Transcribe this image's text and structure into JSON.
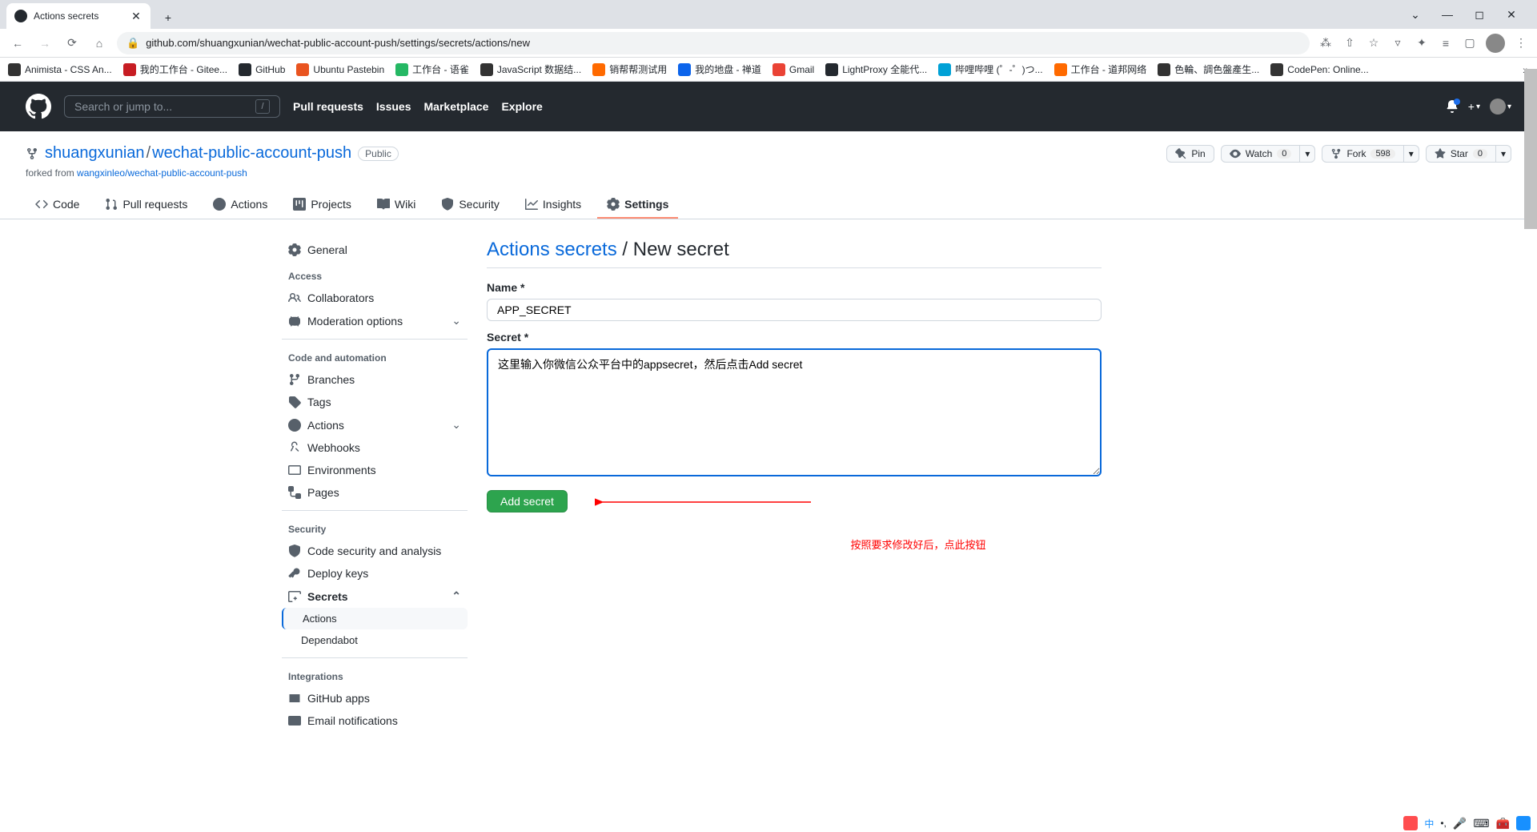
{
  "browser": {
    "tab_title": "Actions secrets",
    "url": "github.com/shuangxunian/wechat-public-account-push/settings/secrets/actions/new"
  },
  "bookmarks": [
    {
      "label": "Animista - CSS An...",
      "color": "#333"
    },
    {
      "label": "我的工作台 - Gitee...",
      "color": "#c71d23"
    },
    {
      "label": "GitHub",
      "color": "#24292f"
    },
    {
      "label": "Ubuntu Pastebin",
      "color": "#e95420"
    },
    {
      "label": "工作台 - 语雀",
      "color": "#25b864"
    },
    {
      "label": "JavaScript 数据结...",
      "color": "#333"
    },
    {
      "label": "销帮帮测试用",
      "color": "#ff6a00"
    },
    {
      "label": "我的地盘 - 禅道",
      "color": "#0c64eb"
    },
    {
      "label": "Gmail",
      "color": "#ea4335"
    },
    {
      "label": "LightProxy 全能代...",
      "color": "#24292f"
    },
    {
      "label": "哔哩哔哩 (゜-゜)つ...",
      "color": "#00a1d6"
    },
    {
      "label": "工作台 - 道邦网络",
      "color": "#ff6a00"
    },
    {
      "label": "色輪、調色盤產生...",
      "color": "#333"
    },
    {
      "label": "CodePen: Online...",
      "color": "#333"
    }
  ],
  "gh_header": {
    "search_placeholder": "Search or jump to...",
    "nav": [
      "Pull requests",
      "Issues",
      "Marketplace",
      "Explore"
    ]
  },
  "repo": {
    "owner": "shuangxunian",
    "name": "wechat-public-account-push",
    "visibility": "Public",
    "forked_prefix": "forked from ",
    "forked_from": "wangxinleo/wechat-public-account-push",
    "actions": {
      "pin": "Pin",
      "watch": "Watch",
      "watch_count": "0",
      "fork": "Fork",
      "fork_count": "598",
      "star": "Star",
      "star_count": "0"
    },
    "tabs": [
      "Code",
      "Pull requests",
      "Actions",
      "Projects",
      "Wiki",
      "Security",
      "Insights",
      "Settings"
    ]
  },
  "sidebar": {
    "general": "General",
    "sections": {
      "access": "Access",
      "access_items": [
        "Collaborators",
        "Moderation options"
      ],
      "code": "Code and automation",
      "code_items": [
        "Branches",
        "Tags",
        "Actions",
        "Webhooks",
        "Environments",
        "Pages"
      ],
      "security": "Security",
      "security_items": [
        "Code security and analysis",
        "Deploy keys",
        "Secrets"
      ],
      "secrets_sub": [
        "Actions",
        "Dependabot"
      ],
      "integrations": "Integrations",
      "integrations_items": [
        "GitHub apps",
        "Email notifications"
      ]
    }
  },
  "page": {
    "breadcrumb_link": "Actions secrets",
    "breadcrumb_current": "New secret",
    "name_label": "Name *",
    "name_value": "APP_SECRET",
    "secret_label": "Secret *",
    "secret_value": "这里输入你微信公众平台中的appsecret，然后点击Add secret",
    "submit": "Add secret",
    "annotation": "按照要求修改好后，点此按钮"
  }
}
